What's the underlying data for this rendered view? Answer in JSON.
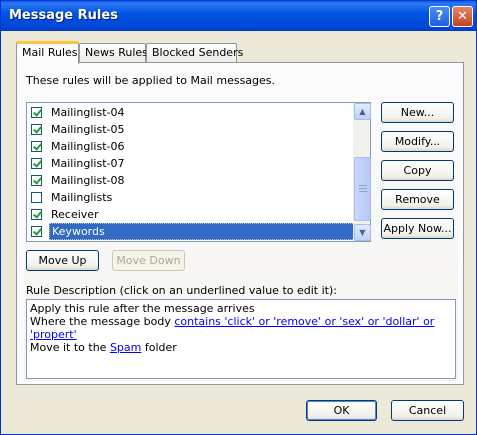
{
  "window": {
    "title": "Message Rules",
    "help_label": "?",
    "close_label": "✕"
  },
  "tabs": [
    {
      "label": "Mail Rules"
    },
    {
      "label": "News Rules"
    },
    {
      "label": "Blocked Senders"
    }
  ],
  "panel": {
    "intro": "These rules will be applied to Mail messages.",
    "rules": [
      {
        "label": "Mailinglist-04",
        "checked": true
      },
      {
        "label": "Mailinglist-05",
        "checked": true
      },
      {
        "label": "Mailinglist-06",
        "checked": true
      },
      {
        "label": "Mailinglist-07",
        "checked": true
      },
      {
        "label": "Mailinglist-08",
        "checked": true
      },
      {
        "label": "Mailinglists",
        "checked": false
      },
      {
        "label": "Receiver",
        "checked": true
      },
      {
        "label": "Keywords",
        "checked": true,
        "selected": true
      }
    ],
    "buttons": {
      "new": "New...",
      "modify": "Modify...",
      "copy": "Copy",
      "remove": "Remove",
      "apply_now": "Apply Now...",
      "move_up": "Move Up",
      "move_down": "Move Down"
    },
    "description_label": "Rule Description (click on an underlined value to edit it):",
    "description": {
      "line1": "Apply this rule after the message arrives",
      "line2_prefix": "Where the message body ",
      "line2_link": "contains 'click' or 'remove' or 'sex' or 'dollar' or 'propert'",
      "line3_prefix": "Move it to the ",
      "line3_link": "Spam",
      "line3_suffix": " folder"
    }
  },
  "footer": {
    "ok": "OK",
    "cancel": "Cancel"
  },
  "icons": {
    "scroll_up": "▲",
    "scroll_down": "▼"
  }
}
